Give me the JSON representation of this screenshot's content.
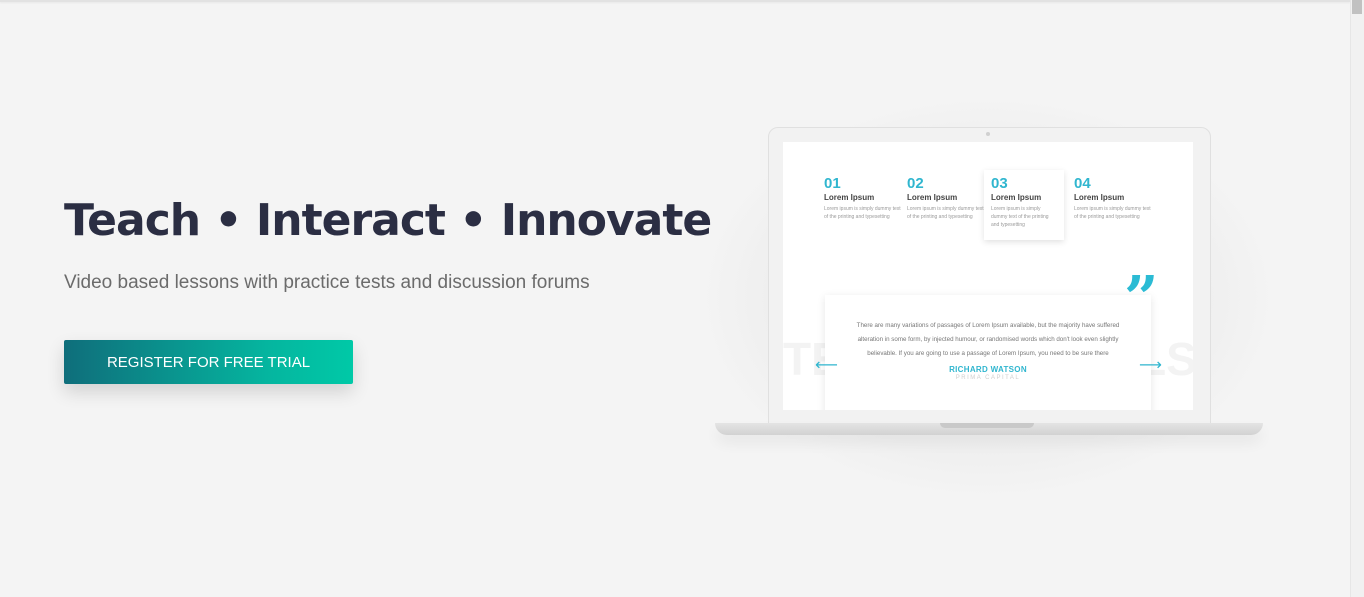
{
  "hero": {
    "title": "Teach • Interact • Innovate",
    "subtitle": "Video based lessons with practice tests and discussion forums",
    "cta_label": "REGISTER FOR FREE TRIAL"
  },
  "mockup": {
    "steps": [
      {
        "number": "01",
        "title": "Lorem Ipsum",
        "text": "Lorem ipsum is simply dummy text of the printing and typesetting"
      },
      {
        "number": "02",
        "title": "Lorem Ipsum",
        "text": "Lorem ipsum is simply dummy text of the printing and typesetting"
      },
      {
        "number": "03",
        "title": "Lorem Ipsum",
        "text": "Lorem ipsum is simply dummy text of the printing and typesetting"
      },
      {
        "number": "04",
        "title": "Lorem Ipsum",
        "text": "Lorem ipsum is simply dummy text of the printing and typesetting"
      }
    ],
    "testimonial": {
      "quote": "There are many variations of passages of Lorem Ipsum available, but the majority have suffered alteration in some form, by injected humour, or randomised words which don't look even slightly believable. If you are going to use a passage of Lorem Ipsum, you need to be sure there",
      "author": "RICHARD WATSON",
      "company": "PRIMA CAPITAL"
    },
    "bg_letters_left": "TE",
    "bg_letters_right": "LS"
  },
  "icons": {
    "quote": "quote-icon",
    "prev": "arrow-left-icon",
    "next": "arrow-right-icon"
  },
  "colors": {
    "accent": "#30b6cf",
    "cta_start": "#0f6e7b",
    "cta_end": "#00c9a7",
    "title": "#2b2e43"
  }
}
